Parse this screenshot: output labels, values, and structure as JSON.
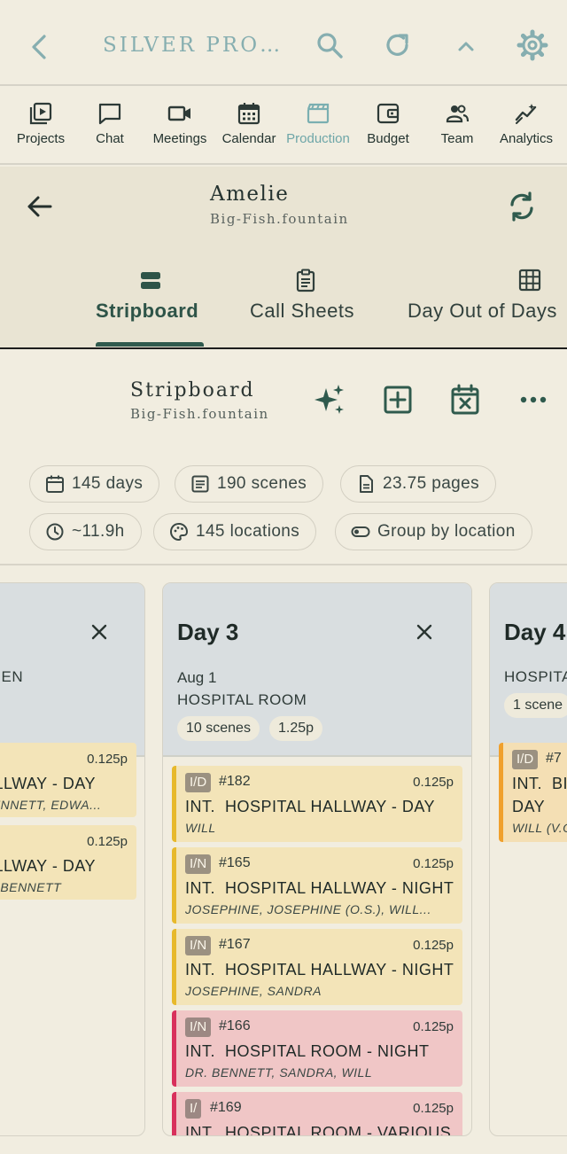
{
  "app": {
    "title": "SILVER PRO…",
    "icons": [
      "back-arrow-icon",
      "search-icon",
      "refresh-icon",
      "chevron-up-icon",
      "gear-icon"
    ],
    "accent": "#6ea6a8"
  },
  "nav": {
    "items": [
      {
        "label": "Projects",
        "icon": "projects-icon"
      },
      {
        "label": "Chat",
        "icon": "chat-icon"
      },
      {
        "label": "Meetings",
        "icon": "video-icon"
      },
      {
        "label": "Calendar",
        "icon": "calendar-icon"
      },
      {
        "label": "Production",
        "icon": "clapperboard-icon",
        "active": true
      },
      {
        "label": "Budget",
        "icon": "wallet-icon"
      },
      {
        "label": "Team",
        "icon": "team-icon"
      },
      {
        "label": "Analytics",
        "icon": "analytics-icon"
      }
    ]
  },
  "project": {
    "name": "Amelie",
    "file": "Big-Fish.fountain",
    "tabs": [
      {
        "label": "Stripboard",
        "icon": "stripboard-icon",
        "active": true
      },
      {
        "label": "Call Sheets",
        "icon": "clipboard-icon"
      },
      {
        "label": "Day Out of Days",
        "icon": "grid-icon"
      }
    ]
  },
  "stripboard": {
    "title": "Stripboard",
    "file": "Big-Fish.fountain",
    "chips": [
      {
        "label": "145 days",
        "icon": "calendar-icon"
      },
      {
        "label": "190 scenes",
        "icon": "list-icon"
      },
      {
        "label": "23.75 pages",
        "icon": "document-icon"
      },
      {
        "label": "~11.9h",
        "icon": "clock-icon"
      },
      {
        "label": "145 locations",
        "icon": "palette-icon"
      },
      {
        "label": "Group by location",
        "icon": "toggle-icon"
      }
    ]
  },
  "days": [
    {
      "title": "",
      "location": "CHEN",
      "strips": [
        {
          "pages": "0.125p",
          "heading": "ALLWAY - DAY",
          "cast": "BENNETT, EDWA..."
        },
        {
          "pages": "0.125p",
          "heading": "ALLWAY - DAY",
          "cast": "R. BENNETT"
        }
      ]
    },
    {
      "title": "Day 3",
      "date": "Aug 1",
      "location": "HOSPITAL ROOM",
      "scenes": "10 scenes",
      "pages": "1.25p",
      "strips": [
        {
          "tag": "I/D",
          "number": "#182",
          "pages": "0.125p",
          "heading": "INT.  HOSPITAL HALLWAY - DAY",
          "cast": "WILL",
          "color": "yellow"
        },
        {
          "tag": "I/N",
          "number": "#165",
          "pages": "0.125p",
          "heading": "INT.  HOSPITAL HALLWAY - NIGHT",
          "cast": "JOSEPHINE, JOSEPHINE (O.S.), WILL...",
          "color": "yellow"
        },
        {
          "tag": "I/N",
          "number": "#167",
          "pages": "0.125p",
          "heading": "INT.  HOSPITAL HALLWAY - NIGHT",
          "cast": "JOSEPHINE, SANDRA",
          "color": "yellow"
        },
        {
          "tag": "I/N",
          "number": "#166",
          "pages": "0.125p",
          "heading": "INT.  HOSPITAL ROOM - NIGHT",
          "cast": "DR. BENNETT, SANDRA, WILL",
          "color": "red"
        },
        {
          "tag": "I/",
          "number": "#169",
          "pages": "0.125p",
          "heading": "INT.  HOSPITAL ROOM - VARIOUS",
          "cast": "",
          "color": "red"
        }
      ]
    },
    {
      "title": "Day 4",
      "location": "HOSPITA",
      "scenes": "1 scene",
      "strips": [
        {
          "tag": "I/D",
          "number": "#7",
          "heading": "INT.  BI",
          "heading2": "DAY",
          "cast": "WILL (V.O"
        }
      ]
    }
  ]
}
